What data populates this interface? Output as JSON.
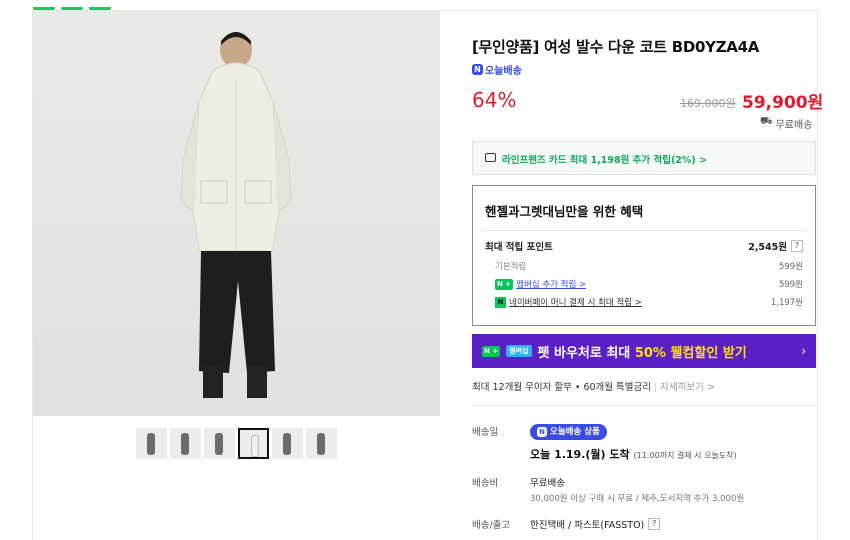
{
  "product": {
    "title": "[무인양품] 여성 발수 다운 코트 BD0YZA4A",
    "delivery_badge": "오늘배송",
    "discount": "64%",
    "original_price": "169,000원",
    "price": "59,900원",
    "shipping": "무료배송"
  },
  "card_offer": "라인프렌즈 카드 최대 1,198원 추가 적립(2%) >",
  "benefit": {
    "heading": "헨젤과그렛대님만을 위한 혜택",
    "max_points_label": "최대 적립 포인트",
    "max_points_value": "2,545원",
    "help": "?",
    "rows": [
      {
        "label": "기본적립",
        "value": "599원"
      },
      {
        "label": "멤버십 추가 적립 >",
        "value": "599원"
      },
      {
        "label": "네이버페이 머니 결제 시 최대 적립 >",
        "value": "1,197원"
      }
    ]
  },
  "promo": {
    "badge_n": "N +",
    "badge_text": "멤버십",
    "text_pre": "펫 바우처로 최대 ",
    "text_highlight": "50% 웰컴할인 받기",
    "arrow": "›"
  },
  "installment": {
    "text": "최대 12개월 무이자 할부 • 60개월 특별금리",
    "more": "자세히보기 >"
  },
  "delivery": {
    "label_date": "배송일",
    "pill": "오늘배송 상품",
    "arrive_main": "오늘 1.19.(월) 도착",
    "arrive_note": "(11:00까지 결제 시 오늘도착)",
    "label_fee": "배송비",
    "fee": "무료배송",
    "fee_note": "30,000원 이상 구매 시 무료 / 제주,도서지역 추가 3,000원",
    "label_courier": "배송/출고",
    "courier": "한진택배 / 파스토(FASSTO)"
  },
  "colors": {
    "accent_red": "#e0192e",
    "naver_green": "#03c75a",
    "purple": "#5b1fc7"
  }
}
